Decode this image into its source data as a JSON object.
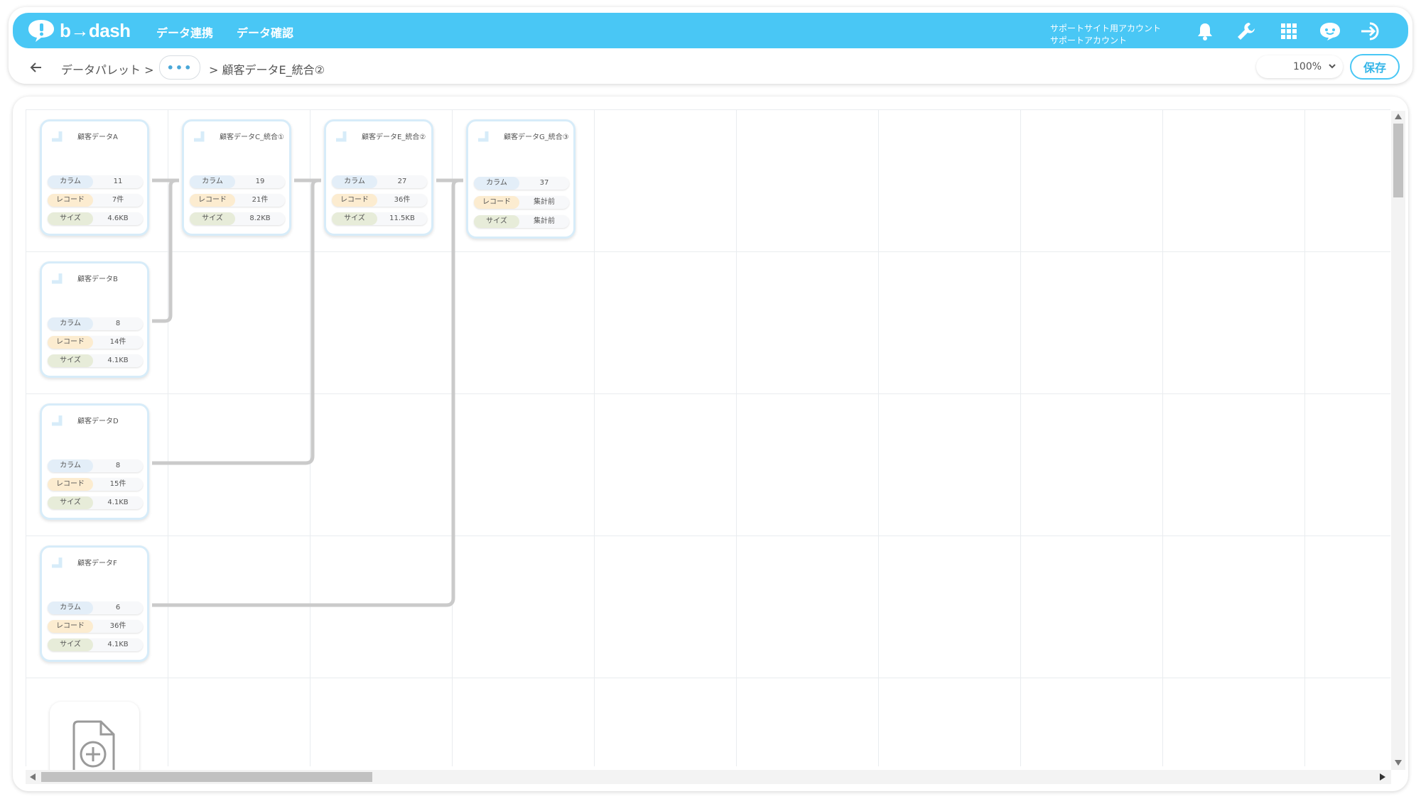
{
  "nav": {
    "logo_text": "b→dash",
    "links": [
      "データ連携",
      "データ確認"
    ],
    "account_line1": "サポートサイト用アカウント",
    "account_line2": "サポートアカウント",
    "icons": [
      "bell-icon",
      "wrench-icon",
      "grid-icon",
      "support-chat-icon",
      "logout-icon"
    ]
  },
  "breadcrumb": {
    "root": "データパレット >",
    "ellipsis": "•••",
    "current": "> 顧客データE_統合②"
  },
  "toolbar": {
    "zoom": "100%",
    "save_label": "保存"
  },
  "labels": {
    "column": "カラム",
    "record": "レコード",
    "size": "サイズ"
  },
  "nodes": [
    {
      "title": "顧客データA",
      "column": "11",
      "record": "7件",
      "size": "4.6KB"
    },
    {
      "title": "顧客データC_統合①",
      "column": "19",
      "record": "21件",
      "size": "8.2KB"
    },
    {
      "title": "顧客データE_統合②",
      "column": "27",
      "record": "36件",
      "size": "11.5KB"
    },
    {
      "title": "顧客データG_統合③",
      "column": "37",
      "record": "集計前",
      "size": "集計前"
    },
    {
      "title": "顧客データB",
      "column": "8",
      "record": "14件",
      "size": "4.1KB"
    },
    {
      "title": "顧客データD",
      "column": "8",
      "record": "15件",
      "size": "4.1KB"
    },
    {
      "title": "顧客データF",
      "column": "6",
      "record": "36件",
      "size": "4.1KB"
    }
  ],
  "colors": {
    "accent": "#49c7f5",
    "column_label": "#e3eef8",
    "record_label": "#fcecd0",
    "size_label": "#e7ecd9"
  }
}
